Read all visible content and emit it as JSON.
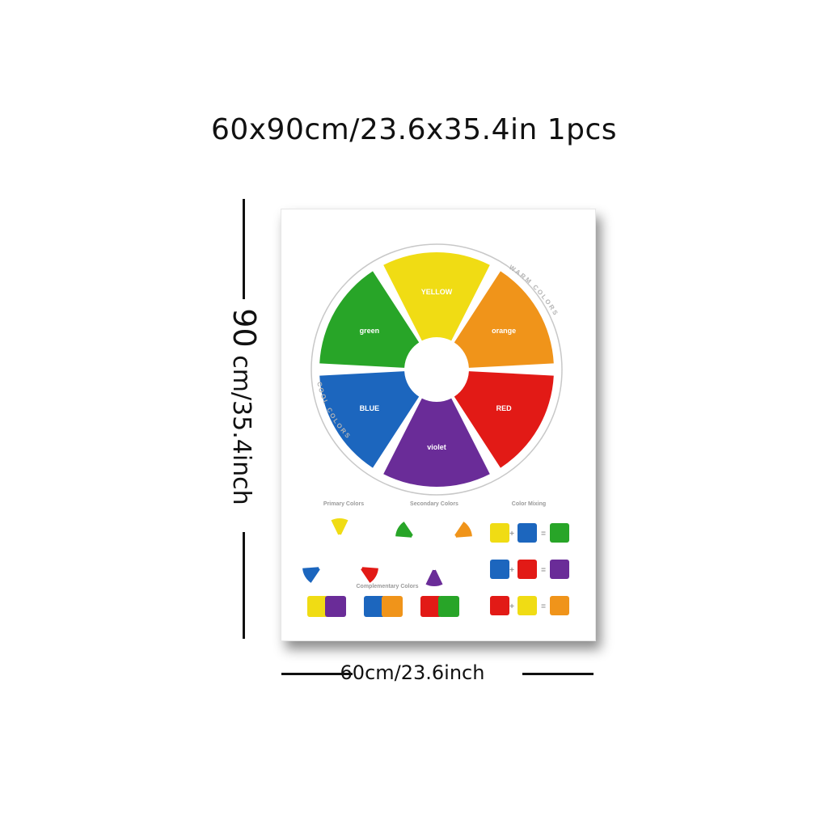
{
  "title": "60x90cm/23.6x35.4in 1pcs",
  "dimensions": {
    "height_number": "90",
    "height_unit": "cm/35.4inch",
    "width_label": "60cm/23.6inch"
  },
  "poster": {
    "wheel": {
      "segments": [
        {
          "label": "YELLOW",
          "color": "#f0dc14"
        },
        {
          "label": "orange",
          "color": "#f0941a"
        },
        {
          "label": "RED",
          "color": "#e21a16"
        },
        {
          "label": "violet",
          "color": "#6a2c98"
        },
        {
          "label": "BLUE",
          "color": "#1c66be"
        },
        {
          "label": "green",
          "color": "#28a528"
        }
      ],
      "warm_label": "WARM COLORS",
      "cool_label": "COOL COLORS"
    },
    "sections": {
      "primary": "Primary Colors",
      "secondary": "Secondary Colors",
      "mixing": "Color Mixing",
      "complementary": "Complementary Colors"
    },
    "operators": {
      "plus": "+",
      "equals": "="
    },
    "mixing": [
      [
        "#f0dc14",
        "#1c66be",
        "#28a528"
      ],
      [
        "#1c66be",
        "#e21a16",
        "#6a2c98"
      ],
      [
        "#e21a16",
        "#f0dc14",
        "#f0941a"
      ]
    ],
    "complementary": [
      [
        "#f0dc14",
        "#6a2c98"
      ],
      [
        "#1c66be",
        "#f0941a"
      ],
      [
        "#e21a16",
        "#28a528"
      ]
    ]
  }
}
